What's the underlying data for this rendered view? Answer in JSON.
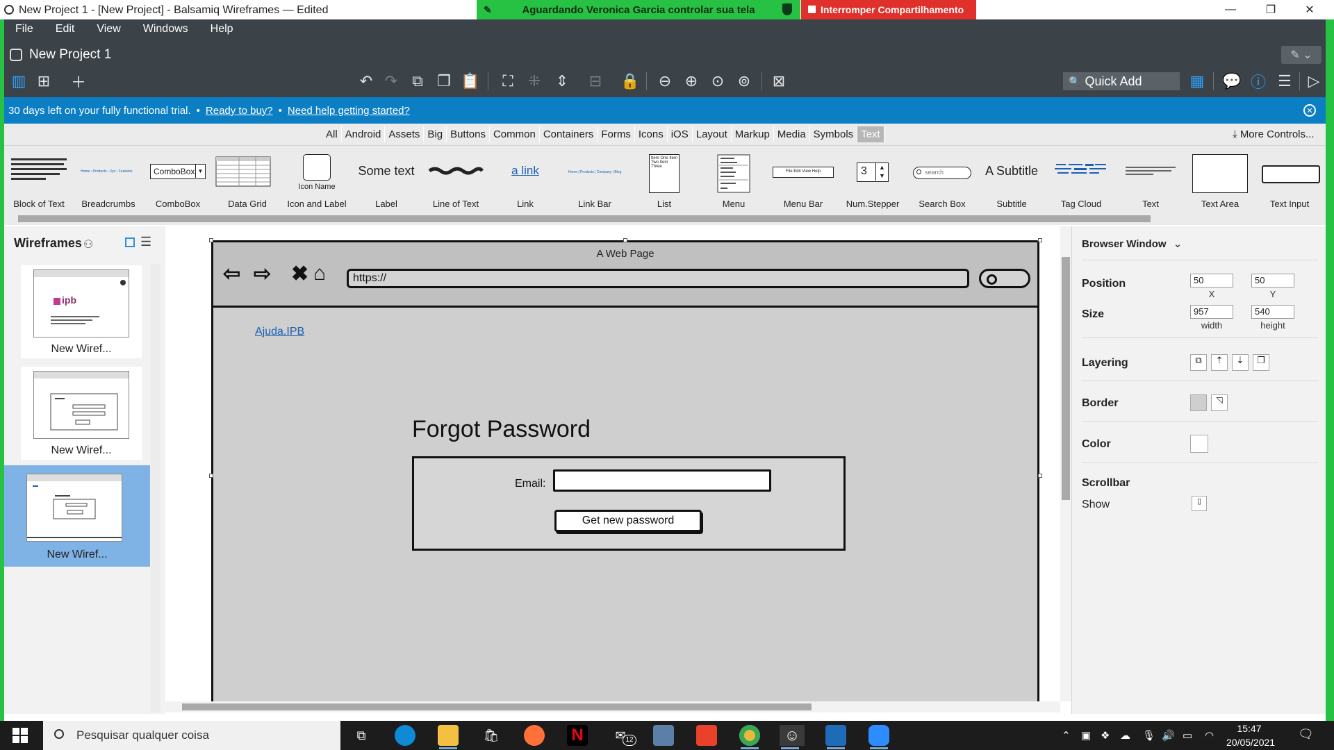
{
  "window": {
    "title": "New Project 1 - [New Project] - Balsamiq Wireframes — Edited",
    "share_status": "Aguardando Veronica Garcia controlar sua tela",
    "stop_sharing": "Interromper Compartilhamento",
    "minimize": "—",
    "restore": "❐",
    "close": "✕"
  },
  "menu": [
    "File",
    "Edit",
    "View",
    "Windows",
    "Help"
  ],
  "project": {
    "title": "New Project 1",
    "quick_add_placeholder": "Quick Add"
  },
  "trial": {
    "message": "30 days left on your fully functional trial.",
    "bullet": "•",
    "ready_link": "Ready to buy?",
    "help_link": "Need help getting started?"
  },
  "categories": [
    "All",
    "Android",
    "Assets",
    "Big",
    "Buttons",
    "Common",
    "Containers",
    "Forms",
    "Icons",
    "iOS",
    "Layout",
    "Markup",
    "Media",
    "Symbols",
    "Text"
  ],
  "active_category": "Text",
  "more_controls": "More Controls...",
  "components": [
    {
      "label": "Block of Text"
    },
    {
      "label": "Breadcrumbs",
      "preview": "Home › Products › Xyz › Features"
    },
    {
      "label": "ComboBox",
      "preview": "ComboBox"
    },
    {
      "label": "Data Grid"
    },
    {
      "label": "Icon and Label",
      "preview": "Icon Name"
    },
    {
      "label": "Label",
      "preview": "Some text"
    },
    {
      "label": "Line of Text"
    },
    {
      "label": "Link",
      "preview": "a link"
    },
    {
      "label": "Link Bar",
      "preview": "Home | Products | Company | Blog"
    },
    {
      "label": "List",
      "preview": "Item One Item Two Item Three"
    },
    {
      "label": "Menu"
    },
    {
      "label": "Menu Bar",
      "preview": "File Edit View Help"
    },
    {
      "label": "Num.Stepper",
      "preview": "3"
    },
    {
      "label": "Search Box",
      "preview": "search"
    },
    {
      "label": "Subtitle",
      "preview": "A Subtitle"
    },
    {
      "label": "Tag Cloud"
    },
    {
      "label": "Text"
    },
    {
      "label": "Text Area"
    },
    {
      "label": "Text Input"
    }
  ],
  "wireframes_panel": {
    "title": "Wireframes",
    "items": [
      {
        "name": "New Wiref..."
      },
      {
        "name": "New Wiref..."
      },
      {
        "name": "New Wiref...",
        "selected": true
      }
    ]
  },
  "canvas": {
    "browser_title": "A Web Page",
    "url": "https://",
    "link": "Ajuda.IPB",
    "heading": "Forgot Password",
    "email_label": "Email:",
    "button_label": "Get new password"
  },
  "properties": {
    "header": "Browser Window",
    "position_label": "Position",
    "x": "50",
    "y": "50",
    "x_cap": "X",
    "y_cap": "Y",
    "size_label": "Size",
    "width": "957",
    "height": "540",
    "width_cap": "width",
    "height_cap": "height",
    "layering_label": "Layering",
    "border_label": "Border",
    "color_label": "Color",
    "scrollbar_label": "Scrollbar",
    "show_label": "Show"
  },
  "taskbar": {
    "search_placeholder": "Pesquisar qualquer coisa",
    "mail_badge": "12",
    "time": "15:47",
    "date": "20/05/2021"
  },
  "colors": {
    "menu_bg": "#3b4248",
    "trial_bg": "#0c7ec4",
    "share_green": "#27c244",
    "share_red": "#e0302b",
    "selected_wireframe": "#7fb3e6",
    "taskbar_bg": "#1c1c1c"
  }
}
